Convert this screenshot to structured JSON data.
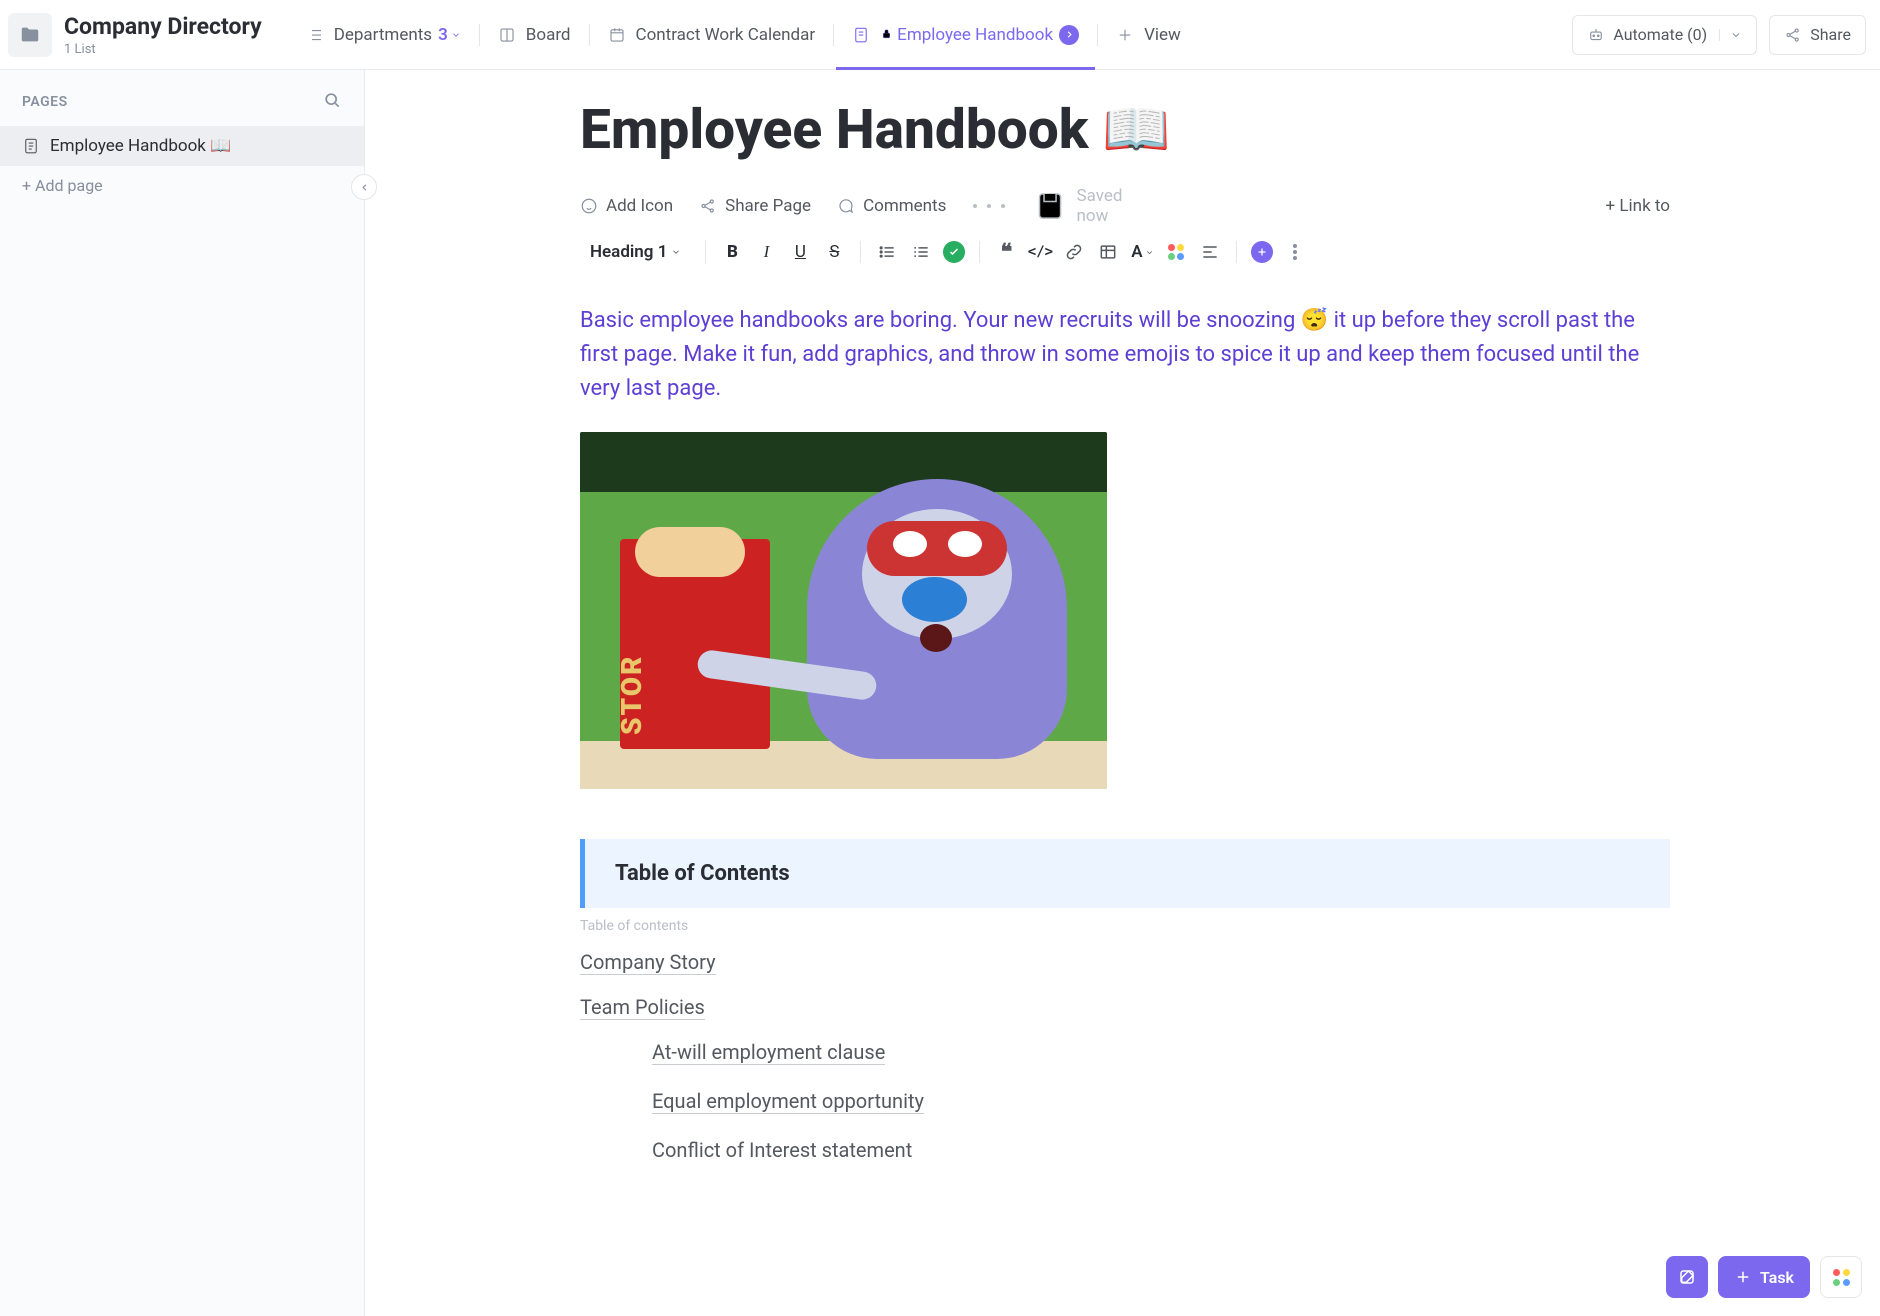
{
  "header": {
    "title": "Company Directory",
    "subtitle": "1 List"
  },
  "tabs": {
    "departments": {
      "label": "Departments",
      "count": "3"
    },
    "board": {
      "label": "Board"
    },
    "contract": {
      "label": "Contract Work Calendar"
    },
    "handbook": {
      "label": "Employee Handbook"
    },
    "view": {
      "label": "View"
    }
  },
  "actions": {
    "automate": {
      "label": "Automate",
      "count": "(0)"
    },
    "share": {
      "label": "Share"
    }
  },
  "sidebar": {
    "pages_label": "PAGES",
    "page1": "Employee Handbook 📖",
    "add_page": "+ Add page"
  },
  "doc": {
    "title": "Employee Handbook 📖",
    "intro": "Basic employee handbooks are boring. Your new recruits will be snoozing 😴 it up before they scroll past the first page. Make it fun, add graphics, and throw in some emojis to spice it up and keep them focused until the very last page."
  },
  "toolbar1": {
    "add_icon": "Add Icon",
    "share_page": "Share Page",
    "comments": "Comments",
    "saved": "Saved now",
    "link_to": "+ Link to"
  },
  "toolbar2": {
    "heading": "Heading 1"
  },
  "toc": {
    "title": "Table of Contents",
    "sublabel": "Table of contents",
    "items": {
      "0": "Company Story",
      "1": "Team Policies",
      "2": "At-will employment clause",
      "3": "Equal employment opportunity",
      "4": "Conflict of Interest statement"
    }
  },
  "float": {
    "task": "Task"
  }
}
